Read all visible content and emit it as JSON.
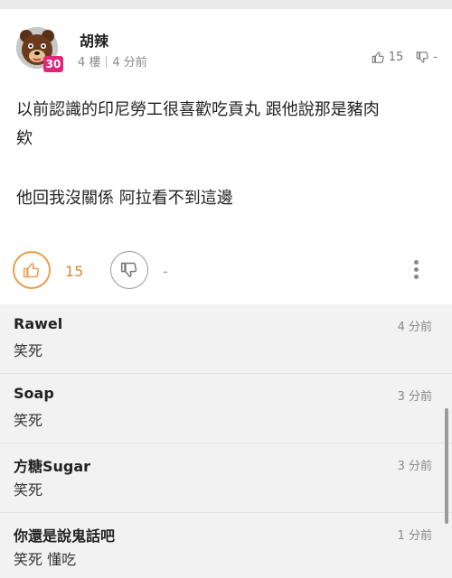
{
  "post": {
    "author": "胡辣",
    "level": "30",
    "floor": "4 樓",
    "time": "4 分前",
    "top_like_count": "15",
    "top_dislike_count": "-",
    "body_lines": [
      "以前認識的印尼勞工很喜歡吃貢丸 跟他說那是豬肉",
      "欸",
      "他回我沒關係 阿拉看不到這邊"
    ],
    "like_count": "15",
    "dislike_count": "-"
  },
  "replies": [
    {
      "name": "Rawel",
      "time": "4 分前",
      "text": "笑死"
    },
    {
      "name": "Soap",
      "time": "3 分前",
      "text": "笑死"
    },
    {
      "name": "方糖Sugar",
      "time": "3 分前",
      "text": "笑死"
    },
    {
      "name": "你還是說鬼話吧",
      "time": "1 分前",
      "text": "笑死 懂吃"
    }
  ],
  "icons": {
    "like": "thumbs-up-icon",
    "dislike": "thumbs-down-icon",
    "more": "more-vertical-icon"
  },
  "colors": {
    "accent": "#e89f52",
    "level_badge": "#e0287a",
    "reply_background": "#f2f2f2"
  }
}
